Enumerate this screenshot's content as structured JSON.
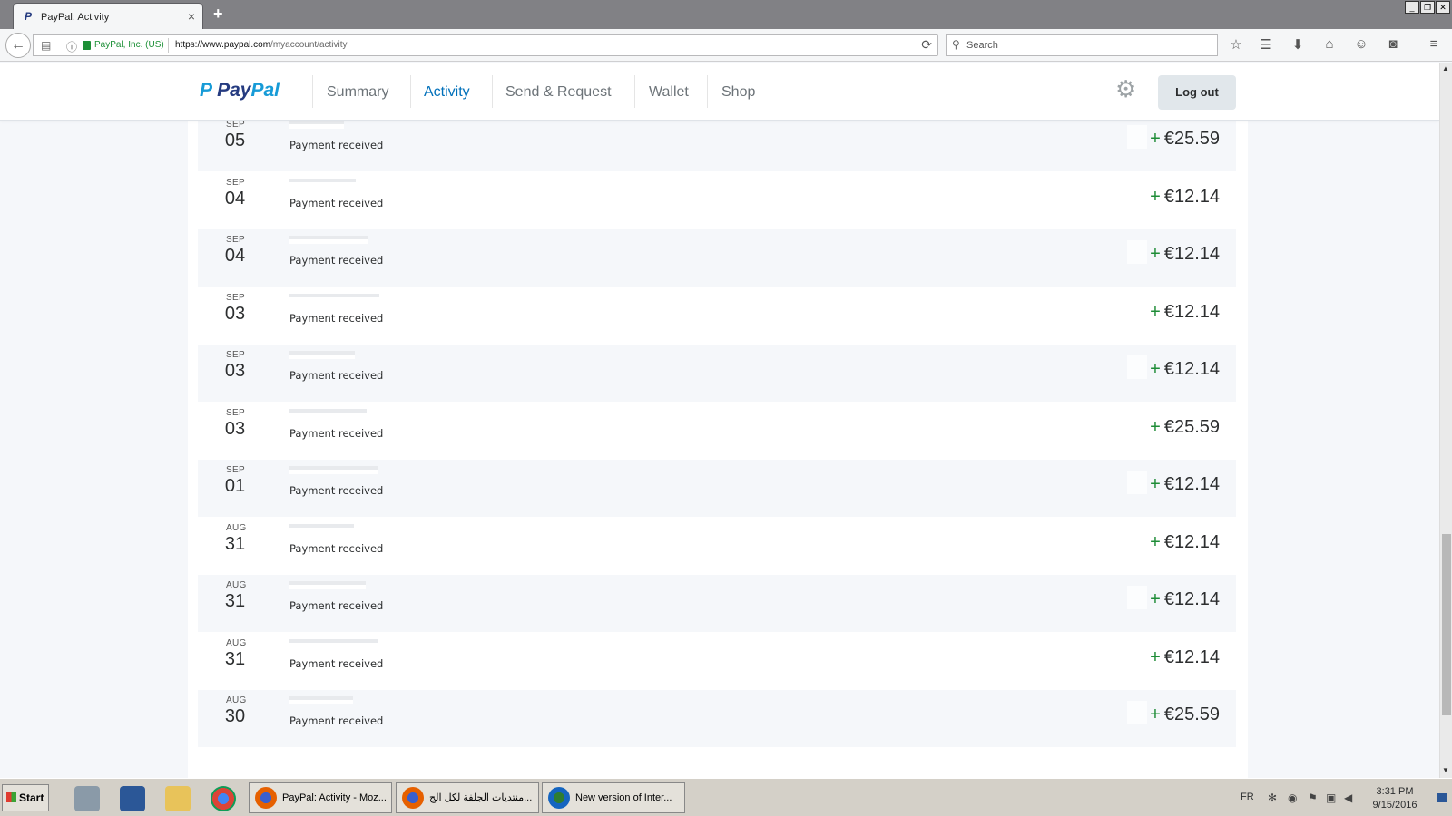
{
  "browser": {
    "tab_title": "PayPal: Activity",
    "tab_close": "×",
    "new_tab": "+",
    "url_org": "PayPal, Inc. (US)",
    "url_host": "https://www.paypal.com",
    "url_path": "/myaccount/activity",
    "search_placeholder": "Search",
    "window_controls": [
      "_",
      "❐",
      "✕"
    ]
  },
  "paypal": {
    "logo_pay": "Pay",
    "logo_pal": "Pal",
    "nav": [
      "Summary",
      "Activity",
      "Send & Request",
      "Wallet",
      "Shop"
    ],
    "active_nav": "Activity",
    "logout_label": "Log out"
  },
  "transactions": [
    {
      "month": "SEP",
      "day": "05",
      "type": "Payment received",
      "amount": "€25.59"
    },
    {
      "month": "SEP",
      "day": "04",
      "type": "Payment received",
      "amount": "€12.14"
    },
    {
      "month": "SEP",
      "day": "04",
      "type": "Payment received",
      "amount": "€12.14"
    },
    {
      "month": "SEP",
      "day": "03",
      "type": "Payment received",
      "amount": "€12.14"
    },
    {
      "month": "SEP",
      "day": "03",
      "type": "Payment received",
      "amount": "€12.14"
    },
    {
      "month": "SEP",
      "day": "03",
      "type": "Payment received",
      "amount": "€25.59"
    },
    {
      "month": "SEP",
      "day": "01",
      "type": "Payment received",
      "amount": "€12.14"
    },
    {
      "month": "AUG",
      "day": "31",
      "type": "Payment received",
      "amount": "€12.14"
    },
    {
      "month": "AUG",
      "day": "31",
      "type": "Payment received",
      "amount": "€12.14"
    },
    {
      "month": "AUG",
      "day": "31",
      "type": "Payment received",
      "amount": "€12.14"
    },
    {
      "month": "AUG",
      "day": "30",
      "type": "Payment received",
      "amount": "€25.59"
    }
  ],
  "plus_sign": "+",
  "taskbar": {
    "start_label": "Start",
    "windows": [
      "PayPal: Activity - Moz...",
      "منتديات الجلفة لكل الج...",
      "New version of Inter..."
    ],
    "lang": "FR",
    "time": "3:31 PM",
    "date": "9/15/2016"
  },
  "colors": {
    "paypal_blue": "#0070ba",
    "paypal_dark": "#253b80",
    "paypal_light": "#179bd7",
    "plus_green": "#1e8c37"
  }
}
